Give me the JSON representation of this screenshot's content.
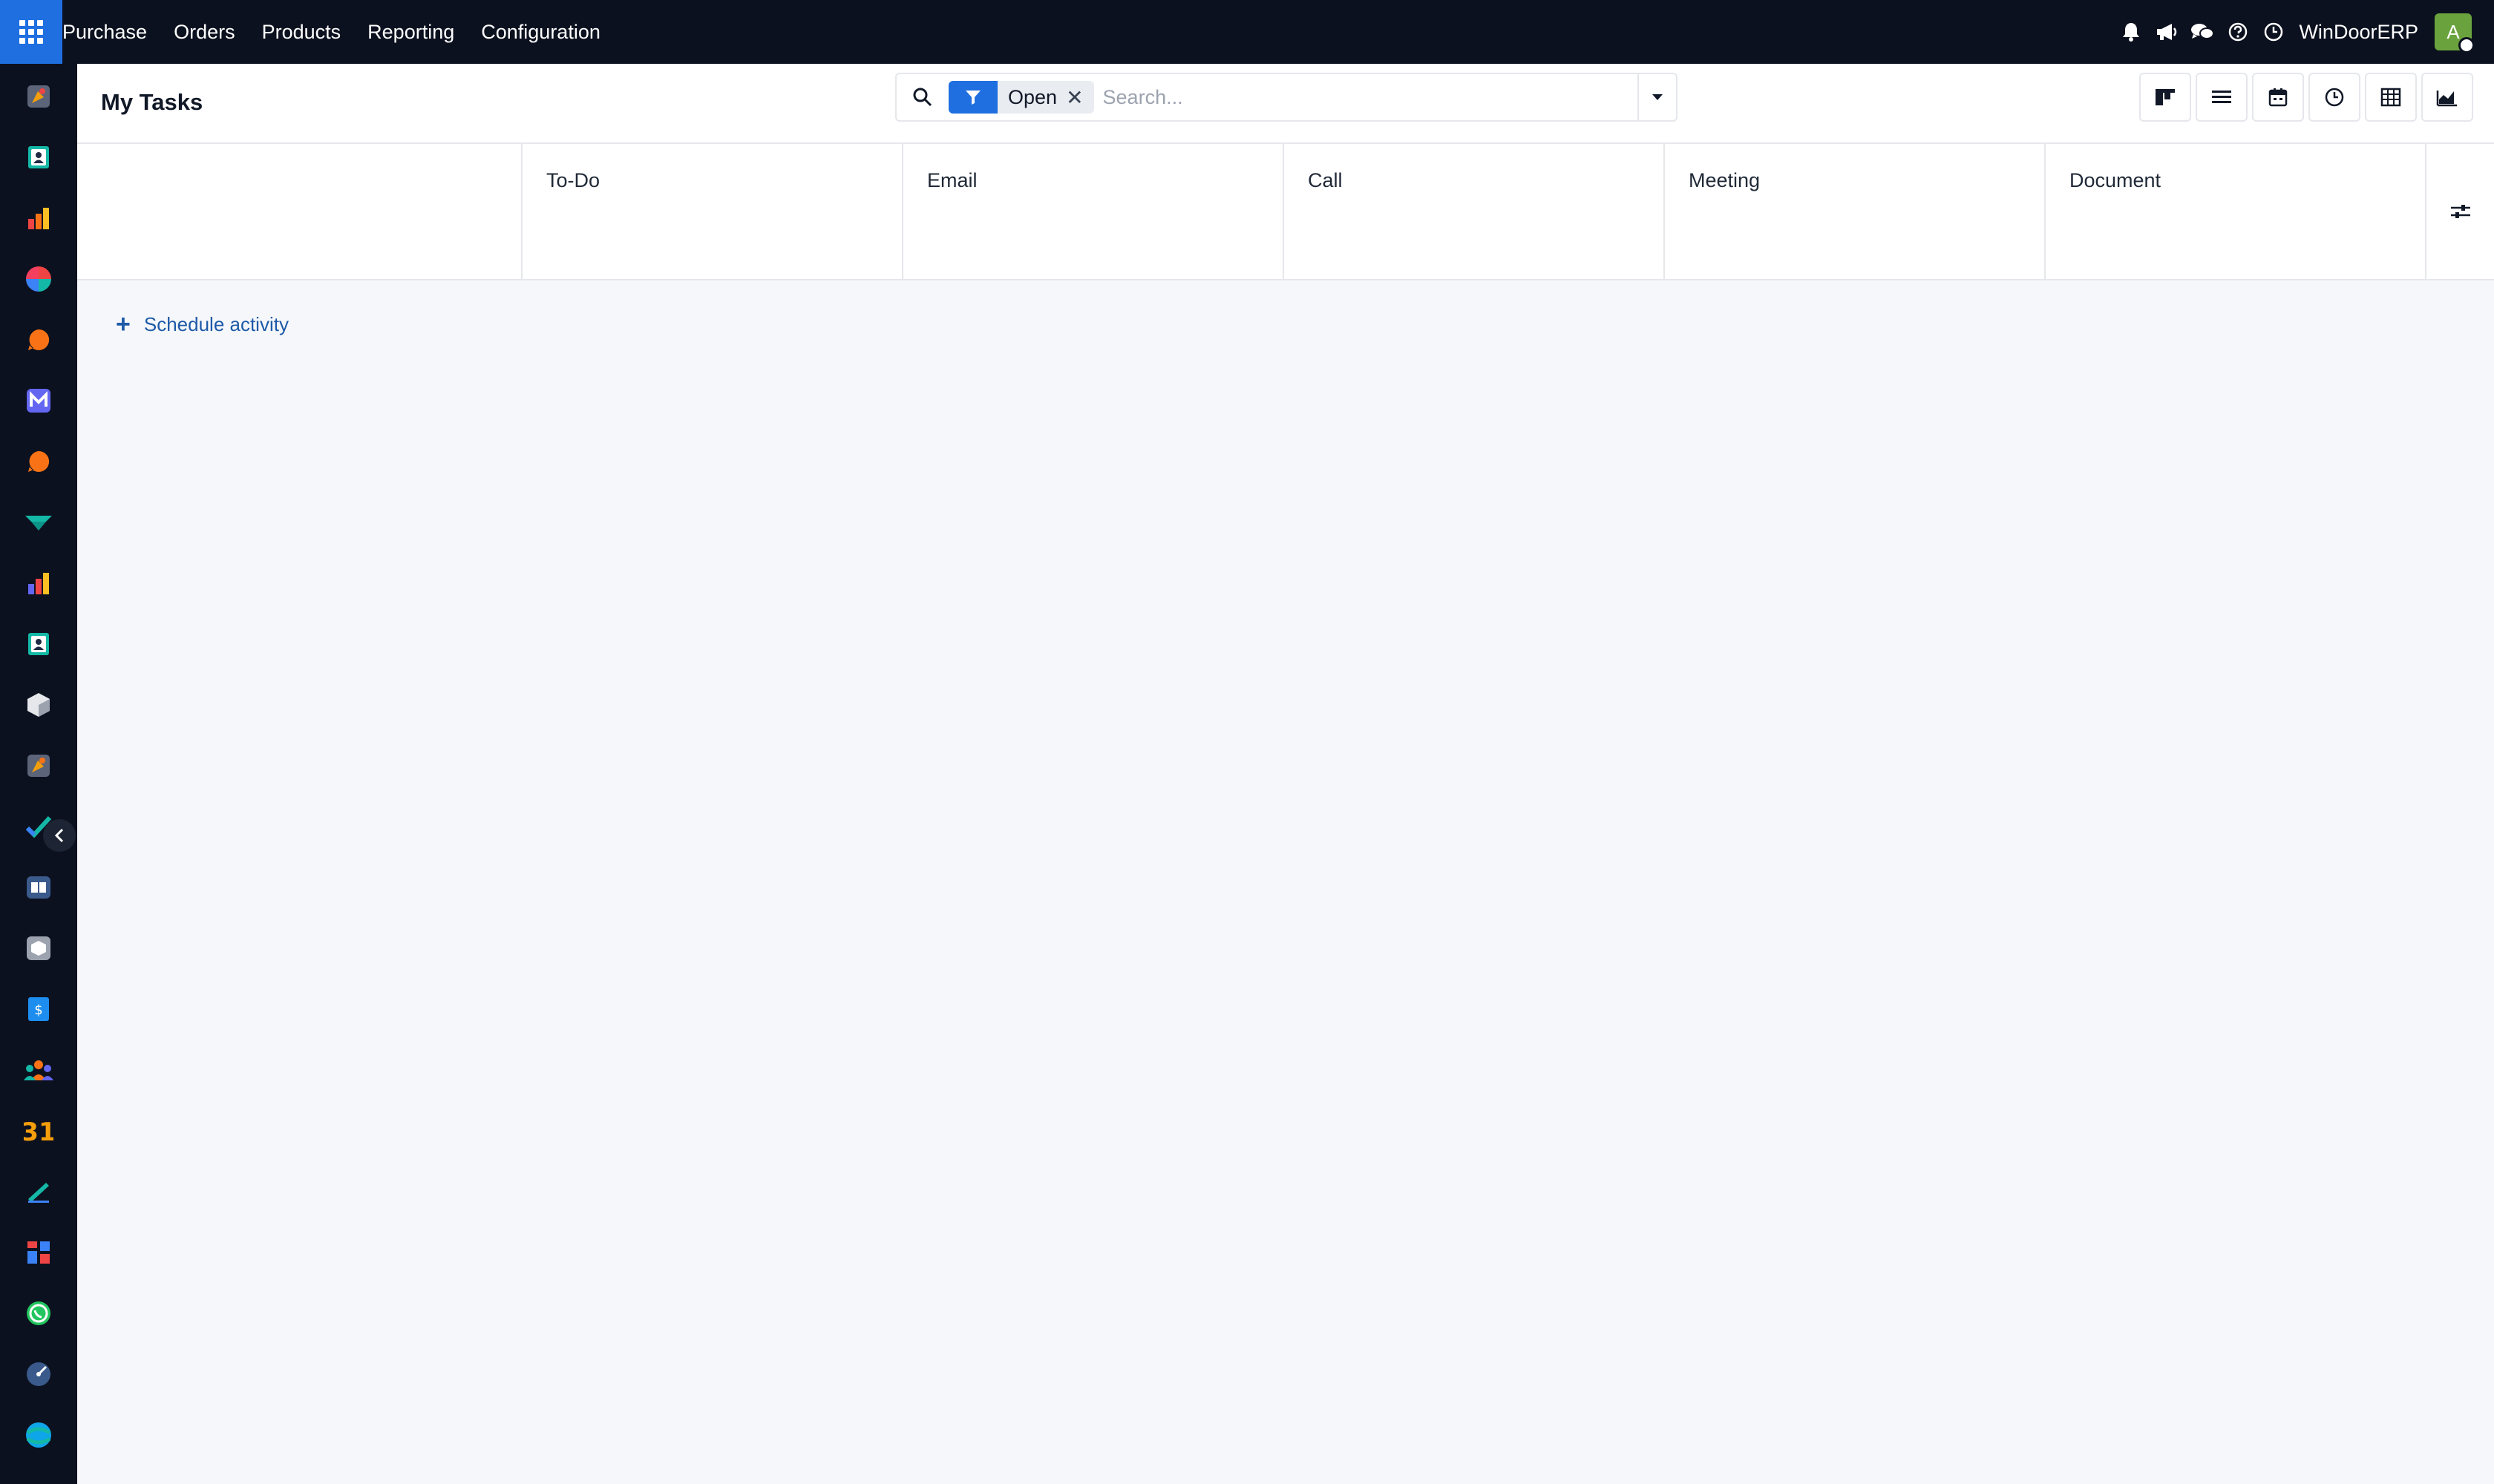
{
  "navbar": {
    "menu": [
      "Purchase",
      "Orders",
      "Products",
      "Reporting",
      "Configuration"
    ],
    "icons": [
      "bell-icon",
      "megaphone-icon",
      "chat-icon",
      "help-icon",
      "clock-icon"
    ],
    "company": "WinDoorERP",
    "avatar_initial": "A"
  },
  "sidebar": {
    "apps": [
      "purchase-app-icon",
      "contacts-app-icon",
      "reporting-app-icon",
      "dashboard-app-icon",
      "discuss-app-icon",
      "email-marketing-app-icon",
      "livechat-app-icon",
      "sign-app-icon",
      "sales-app-icon",
      "employees-app-icon",
      "inventory-app-icon",
      "manufacturing-app-icon",
      "project-app-icon",
      "knowledge-app-icon",
      "barcode-app-icon",
      "invoicing-app-icon",
      "team-app-icon",
      "calendar-app-icon",
      "notes-app-icon",
      "website-app-icon",
      "whatsapp-app-icon",
      "time-off-app-icon",
      "studio-app-icon"
    ]
  },
  "control": {
    "title": "My Tasks",
    "facet_label": "Open",
    "search_placeholder": "Search...",
    "views": [
      "kanban-view-icon",
      "list-view-icon",
      "calendar-view-icon",
      "activity-view-icon",
      "pivot-view-icon",
      "graph-view-icon"
    ]
  },
  "activity": {
    "columns": [
      "To-Do",
      "Email",
      "Call",
      "Meeting",
      "Document"
    ],
    "schedule_label": "Schedule activity"
  },
  "colors": {
    "navbar": "#0c111f",
    "primary": "#1f6fe0",
    "link": "#1e5aa8",
    "avatar": "#6aa33e"
  }
}
